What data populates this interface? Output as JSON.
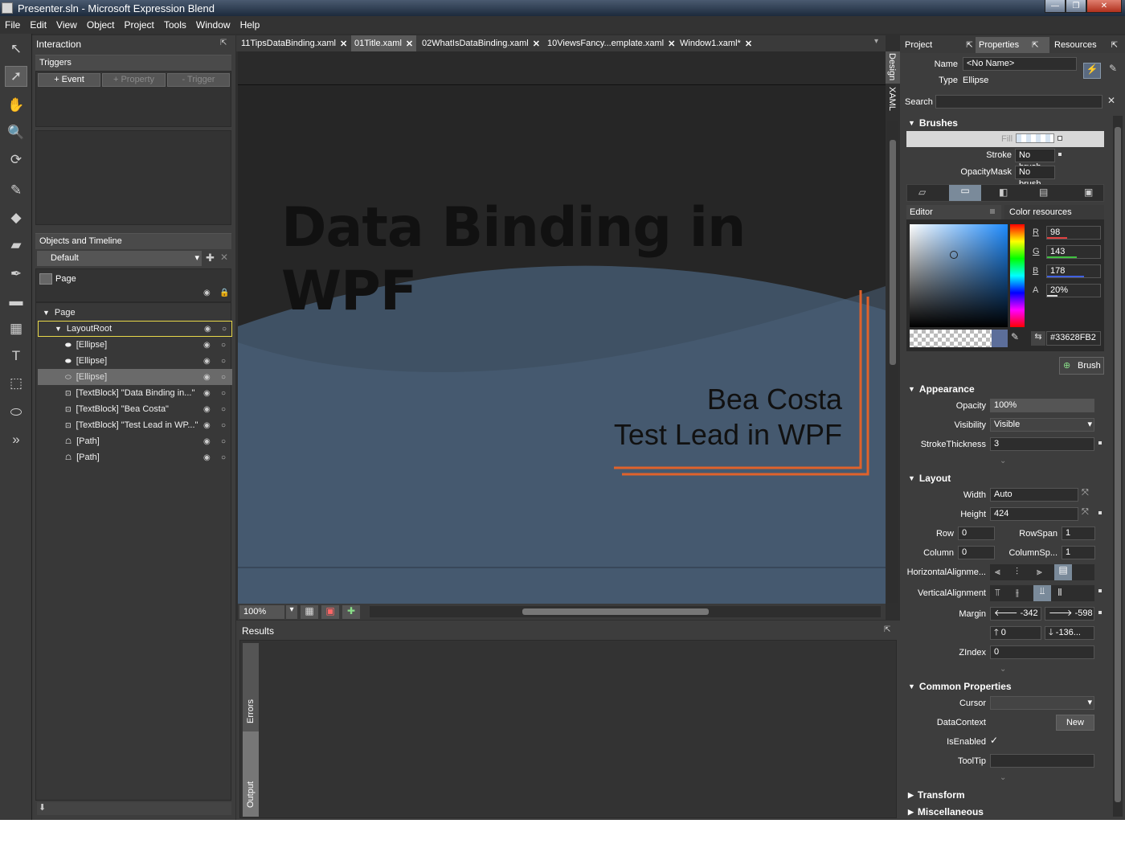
{
  "window": {
    "title": "Presenter.sln - Microsoft Expression Blend",
    "buttons": {
      "minimize": "—",
      "maximize": "❐",
      "close": "✕"
    }
  },
  "menu": [
    "File",
    "Edit",
    "View",
    "Object",
    "Project",
    "Tools",
    "Window",
    "Help"
  ],
  "interaction": {
    "title": "Interaction",
    "triggers_label": "Triggers",
    "event_btn": "+ Event",
    "property_btn": "+ Property",
    "trigger_btn": "- Trigger"
  },
  "objects": {
    "title": "Objects and Timeline",
    "storyboard": "Default",
    "scope": "Page",
    "tree": [
      {
        "label": "Page",
        "indent": 0,
        "expanded": true
      },
      {
        "label": "LayoutRoot",
        "indent": 1,
        "expanded": true,
        "selected": true
      },
      {
        "label": "[Ellipse]",
        "indent": 2,
        "icon": "ellipse-filled"
      },
      {
        "label": "[Ellipse]",
        "indent": 2,
        "icon": "ellipse-filled"
      },
      {
        "label": "[Ellipse]",
        "indent": 2,
        "icon": "ellipse-outline",
        "highlight": true
      },
      {
        "label": "[TextBlock] \"Data Binding in...\"",
        "indent": 2,
        "icon": "textblock"
      },
      {
        "label": "[TextBlock] \"Bea Costa\"",
        "indent": 2,
        "icon": "textblock"
      },
      {
        "label": "[TextBlock] \"Test Lead in WP...\"",
        "indent": 2,
        "icon": "textblock"
      },
      {
        "label": "[Path]",
        "indent": 2,
        "icon": "path"
      },
      {
        "label": "[Path]",
        "indent": 2,
        "icon": "path"
      }
    ]
  },
  "tabs": [
    {
      "label": "11TipsDataBinding.xaml",
      "active": false
    },
    {
      "label": "01Title.xaml",
      "active": true
    },
    {
      "label": "02WhatIsDataBinding.xaml",
      "active": false
    },
    {
      "label": "10ViewsFancy...emplate.xaml",
      "active": false
    },
    {
      "label": "Window1.xaml*",
      "active": false
    }
  ],
  "side_tabs": {
    "design": "Design",
    "xaml": "XAML"
  },
  "slide": {
    "title": "Data Binding in WPF",
    "author": "Bea Costa",
    "role": "Test Lead in WPF"
  },
  "zoom": "100%",
  "results": {
    "title": "Results",
    "errors": "Errors",
    "output": "Output"
  },
  "right_tabs": [
    "Project",
    "Properties",
    "Resources"
  ],
  "properties": {
    "name_label": "Name",
    "name_value": "<No Name>",
    "type_label": "Type",
    "type_value": "Ellipse",
    "search_label": "Search",
    "brushes": {
      "title": "Brushes",
      "fill": "Fill",
      "stroke": "Stroke",
      "stroke_value": "No brush",
      "opacitymask": "OpacityMask",
      "opacitymask_value": "No brush",
      "editor": "Editor",
      "color_resources": "Color resources",
      "r": "98",
      "g": "143",
      "b": "178",
      "a": "20%",
      "r_label": "R",
      "g_label": "G",
      "b_label": "B",
      "a_label": "A",
      "hex": "#33628FB2",
      "brush_btn": "Brush",
      "color": "#628fb2"
    },
    "appearance": {
      "title": "Appearance",
      "opacity_label": "Opacity",
      "opacity": "100%",
      "visibility_label": "Visibility",
      "visibility": "Visible",
      "stroke_label": "StrokeThickness",
      "stroke": "3"
    },
    "layout": {
      "title": "Layout",
      "width_label": "Width",
      "width": "Auto",
      "height_label": "Height",
      "height": "424",
      "row_label": "Row",
      "row": "0",
      "rowspan_label": "RowSpan",
      "rowspan": "1",
      "column_label": "Column",
      "column": "0",
      "columnspan_label": "ColumnSp...",
      "columnspan": "1",
      "halign_label": "HorizontalAlignme...",
      "valign_label": "VerticalAlignment",
      "margin_label": "Margin",
      "margin_left": "-342",
      "margin_right": "-598",
      "margin_top": "0",
      "margin_bottom": "-136...",
      "zindex_label": "ZIndex",
      "zindex": "0"
    },
    "common": {
      "title": "Common Properties",
      "cursor_label": "Cursor",
      "datacontext_label": "DataContext",
      "new_btn": "New",
      "isenabled_label": "IsEnabled",
      "tooltip_label": "ToolTip"
    },
    "transform": "Transform",
    "misc": "Miscellaneous"
  }
}
